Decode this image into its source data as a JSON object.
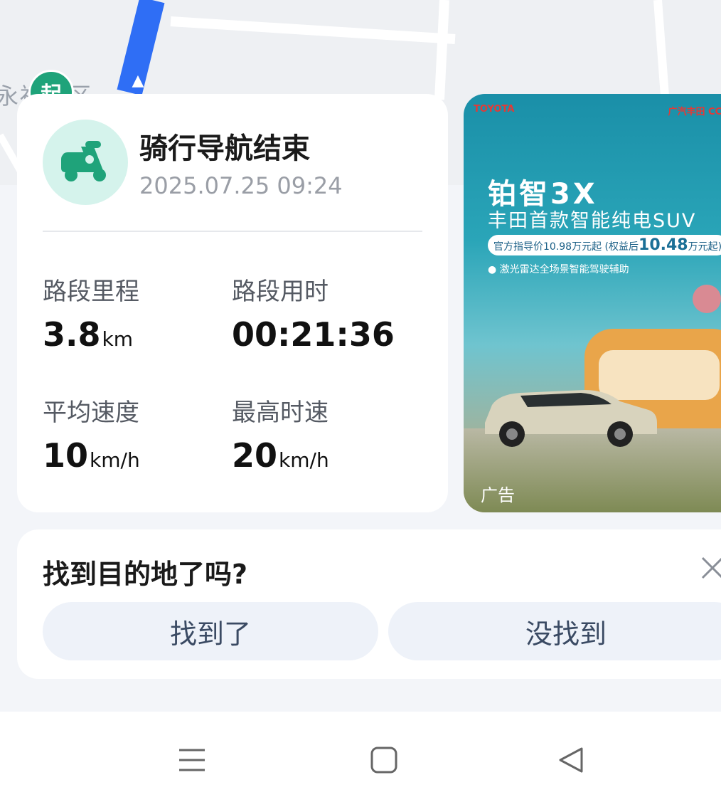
{
  "map": {
    "place_label": "永福社区",
    "start_marker_text": "起",
    "route_color": "#2f6ef5"
  },
  "summary": {
    "title": "骑行导航结束",
    "datetime": "2025.07.25 09:24",
    "icon": "scooter-icon",
    "accent_color": "#1fa37a",
    "stats": [
      {
        "label": "路段里程",
        "value": "3.8",
        "unit": "km"
      },
      {
        "label": "路段用时",
        "value": "00:21:36",
        "unit": ""
      },
      {
        "label": "平均速度",
        "value": "10",
        "unit": "km/h"
      },
      {
        "label": "最高时速",
        "value": "20",
        "unit": "km/h"
      }
    ]
  },
  "ad": {
    "brand": "TOYOTA",
    "brand_right": "广汽丰田 CCT",
    "headline": "铂智3X",
    "subtitle": "丰田首款智能纯电SUV",
    "price_prefix": "官方指导价10.98万元起",
    "price_after": "(权益后",
    "price_value": "10.48",
    "price_suffix": "万元起)",
    "feature": "● 激光雷达全场景智能驾驶辅助",
    "tag": "广告"
  },
  "feedback": {
    "question": "找到目的地了吗?",
    "yes_label": "找到了",
    "no_label": "没找到",
    "close_icon": "close-icon"
  },
  "system_nav": {
    "menu_icon": "menu-icon",
    "home_icon": "home-icon",
    "back_icon": "back-icon"
  }
}
